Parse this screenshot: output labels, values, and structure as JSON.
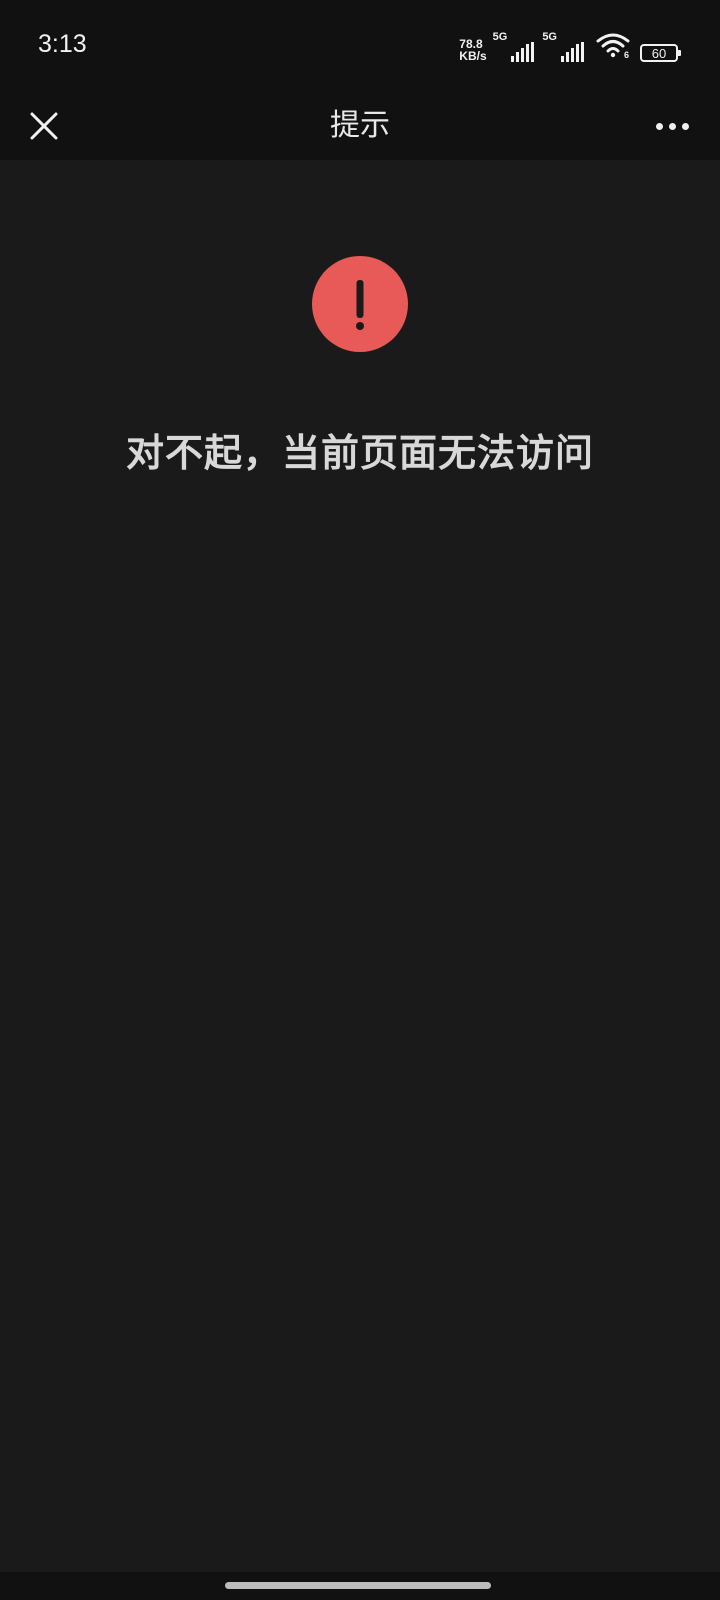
{
  "status_bar": {
    "time": "3:13",
    "net_speed_value": "78.8",
    "net_speed_unit": "KB/s",
    "sim1_label": "5G",
    "sim2_label": "5G",
    "wifi_label": "6",
    "battery_level": "60",
    "icons": [
      "signal-icon",
      "wifi-icon",
      "battery-icon"
    ]
  },
  "nav_bar": {
    "title": "提示",
    "close_icon": "close-icon",
    "more_icon": "more-icon"
  },
  "error": {
    "icon": "exclamation-icon",
    "icon_color": "#e85a57",
    "message": "对不起，当前页面无法访问"
  },
  "colors": {
    "background": "#1a1a1a",
    "bar_background": "#111111",
    "text": "#d8d8d8"
  }
}
